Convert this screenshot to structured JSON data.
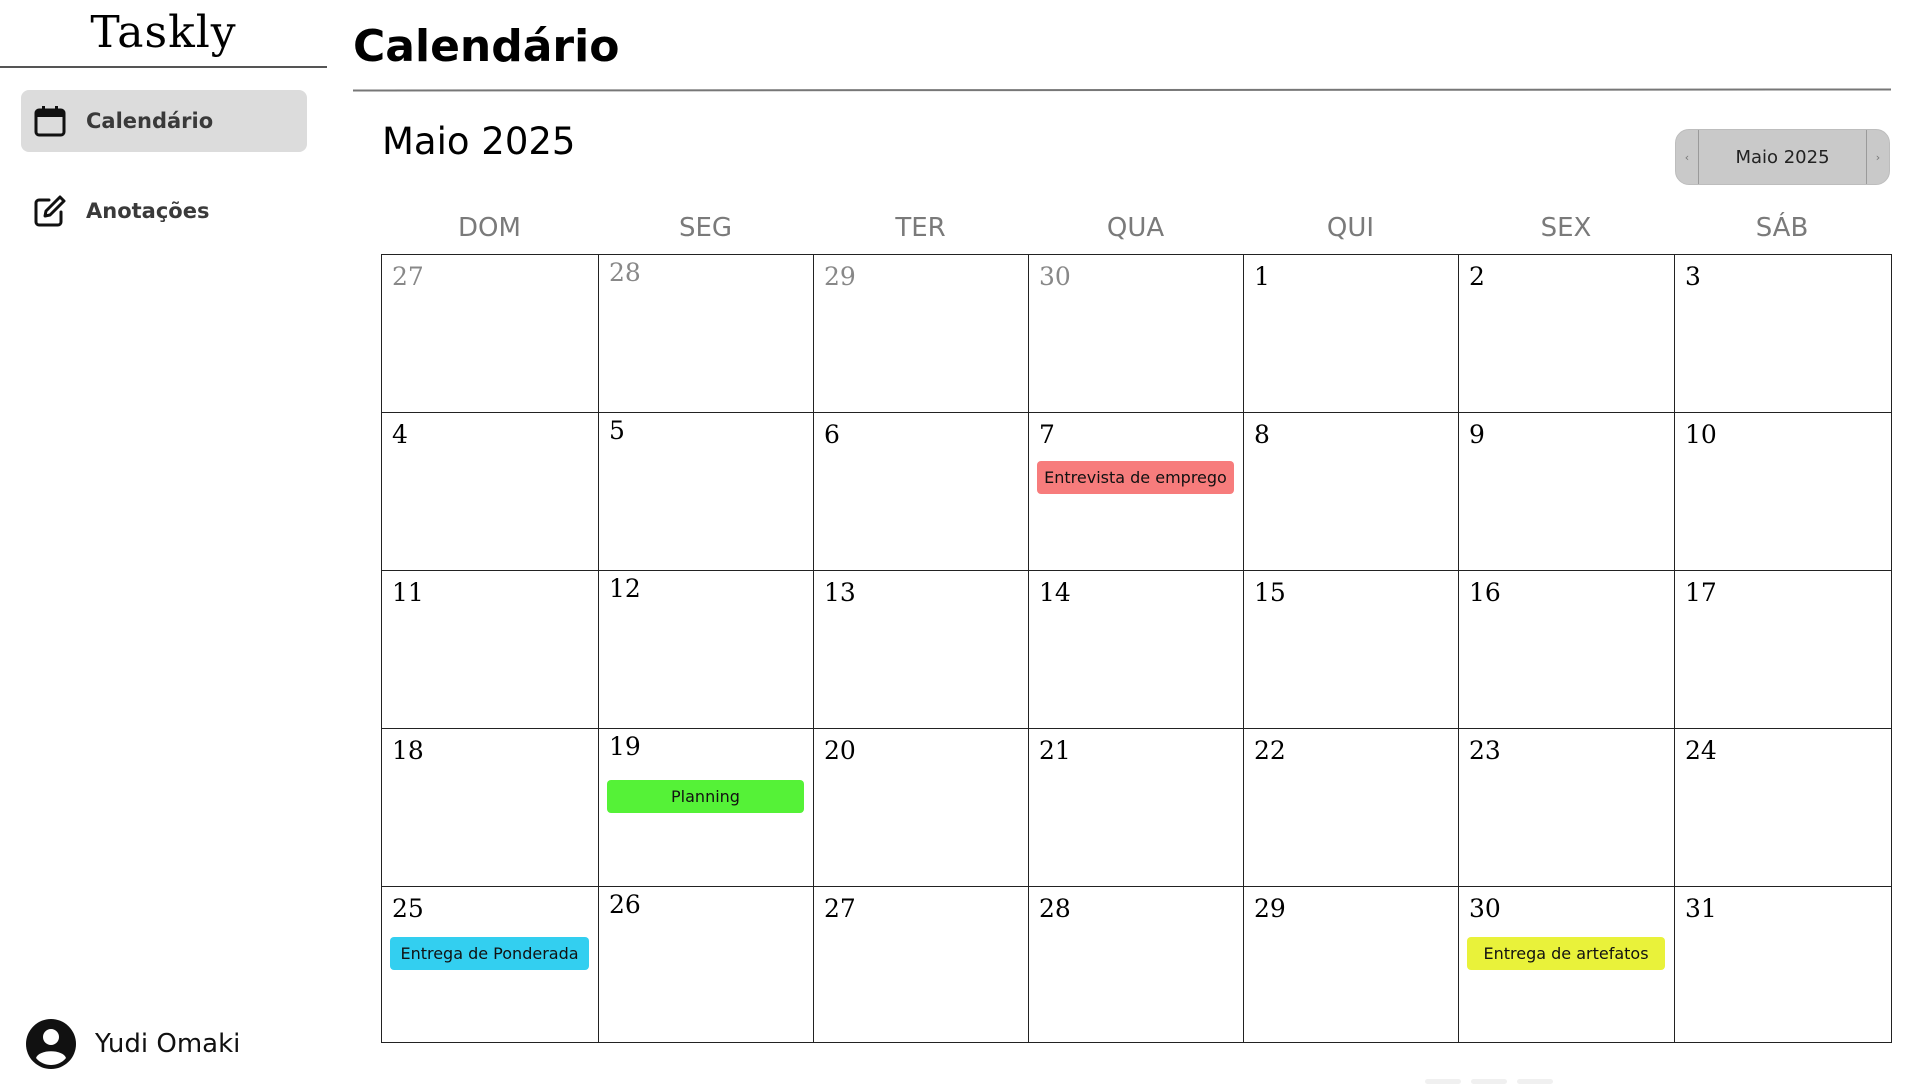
{
  "app": {
    "name": "Taskly"
  },
  "sidebar": {
    "items": [
      {
        "label": "Calendário",
        "icon": "calendar-icon",
        "active": true
      },
      {
        "label": "Anotações",
        "icon": "edit-icon",
        "active": false
      }
    ],
    "user": {
      "name": "Yudi Omaki",
      "icon": "user-avatar-icon"
    }
  },
  "header": {
    "title": "Calendário"
  },
  "calendar": {
    "month_label": "Maio 2025",
    "picker": {
      "value": "Maio 2025",
      "prev_icon": "chevron-left-icon",
      "next_icon": "chevron-right-icon"
    },
    "weekdays": [
      "DOM",
      "SEG",
      "TER",
      "QUA",
      "QUI",
      "SEX",
      "SÁB"
    ],
    "weeks": [
      [
        {
          "day": "27",
          "other": true
        },
        {
          "day": "28",
          "other": true
        },
        {
          "day": "29",
          "other": true
        },
        {
          "day": "30",
          "other": true
        },
        {
          "day": "1"
        },
        {
          "day": "2"
        },
        {
          "day": "3"
        }
      ],
      [
        {
          "day": "4"
        },
        {
          "day": "5"
        },
        {
          "day": "6"
        },
        {
          "day": "7",
          "event": {
            "title": "Entrevista de emprego",
            "color": "#f77c7c"
          }
        },
        {
          "day": "8"
        },
        {
          "day": "9"
        },
        {
          "day": "10"
        }
      ],
      [
        {
          "day": "11"
        },
        {
          "day": "12"
        },
        {
          "day": "13"
        },
        {
          "day": "14"
        },
        {
          "day": "15"
        },
        {
          "day": "16"
        },
        {
          "day": "17"
        }
      ],
      [
        {
          "day": "18"
        },
        {
          "day": "19",
          "event": {
            "title": "Planning",
            "color": "#55f237"
          }
        },
        {
          "day": "20"
        },
        {
          "day": "21"
        },
        {
          "day": "22"
        },
        {
          "day": "23"
        },
        {
          "day": "24"
        }
      ],
      [
        {
          "day": "25",
          "event": {
            "title": "Entrega de Ponderada",
            "color": "#33cff0"
          }
        },
        {
          "day": "26"
        },
        {
          "day": "27"
        },
        {
          "day": "28"
        },
        {
          "day": "29"
        },
        {
          "day": "30",
          "event": {
            "title": "Entrega de artefatos",
            "color": "#e9f23a"
          }
        },
        {
          "day": "31"
        }
      ]
    ]
  }
}
